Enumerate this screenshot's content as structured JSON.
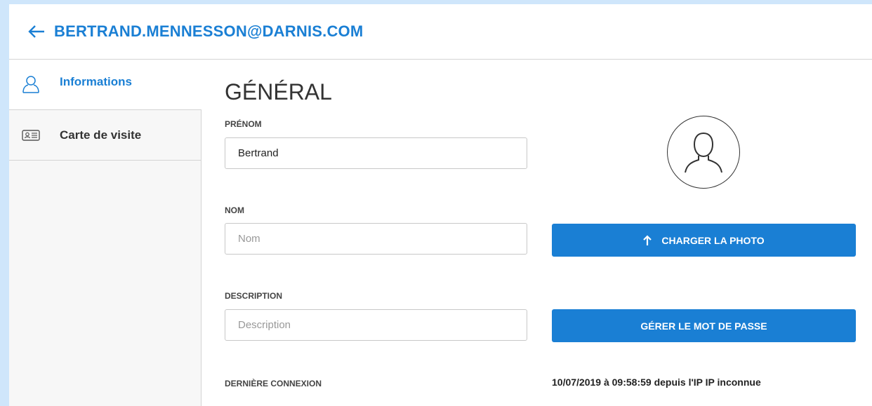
{
  "header": {
    "title": "BERTRAND.MENNESSON@DARNIS.COM",
    "back_icon": "arrow-left-icon"
  },
  "sidebar": {
    "items": [
      {
        "label": "Informations",
        "icon": "user-outline-icon",
        "active": true
      },
      {
        "label": "Carte de visite",
        "icon": "id-card-icon",
        "active": false
      }
    ]
  },
  "main": {
    "section_title": "GÉNÉRAL",
    "prenom": {
      "label": "PRÉNOM",
      "value": "Bertrand"
    },
    "nom": {
      "label": "NOM",
      "value": "",
      "placeholder": "Nom"
    },
    "description": {
      "label": "DESCRIPTION",
      "value": "",
      "placeholder": "Description"
    },
    "upload_button": "CHARGER LA PHOTO",
    "password_button": "GÉRER LE MOT DE PASSE",
    "last_connection": {
      "label": "DERNIÈRE CONNEXION",
      "value": "10/07/2019 à 09:58:59 depuis l'IP IP inconnue"
    }
  },
  "colors": {
    "accent": "#1a7fd4",
    "frame": "#cfe6fb"
  }
}
